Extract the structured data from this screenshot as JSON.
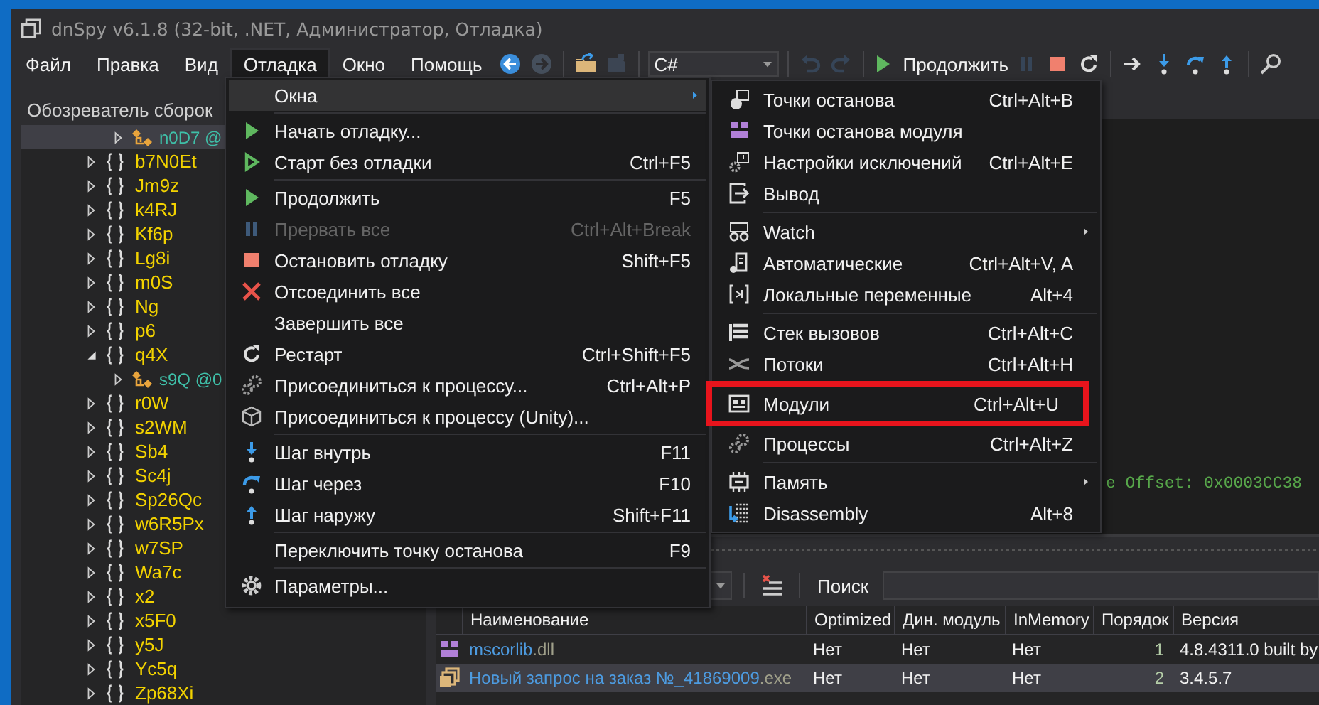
{
  "window": {
    "title": "dnSpy v6.1.8 (32-bit, .NET, Администратор, Отладка)"
  },
  "menu_bar": [
    {
      "label": "Файл",
      "selected": false
    },
    {
      "label": "Правка",
      "selected": false
    },
    {
      "label": "Вид",
      "selected": false
    },
    {
      "label": "Отладка",
      "selected": true
    },
    {
      "label": "Окно",
      "selected": false
    },
    {
      "label": "Помощь",
      "selected": false
    }
  ],
  "toolbar": [
    {
      "kind": "icon",
      "disabled": false
    },
    {
      "kind": "icon",
      "disabled": true
    },
    {
      "kind": "separator"
    },
    {
      "kind": "icon",
      "disabled": false
    },
    {
      "kind": "icon",
      "disabled": true
    },
    {
      "kind": "separator"
    },
    {
      "kind": "combo",
      "value": "C#"
    },
    {
      "kind": "separator"
    },
    {
      "kind": "icon",
      "disabled": true
    },
    {
      "kind": "icon",
      "disabled": true
    },
    {
      "kind": "separator"
    },
    {
      "kind": "labeled",
      "label": "Продолжить",
      "disabled": false
    },
    {
      "kind": "icon",
      "disabled": true
    },
    {
      "kind": "icon",
      "disabled": false
    },
    {
      "kind": "icon",
      "disabled": false
    },
    {
      "kind": "separator"
    },
    {
      "kind": "icon",
      "disabled": false
    },
    {
      "kind": "icon",
      "disabled": false
    },
    {
      "kind": "icon",
      "disabled": false
    },
    {
      "kind": "icon",
      "disabled": false
    },
    {
      "kind": "separator"
    },
    {
      "kind": "icon",
      "disabled": false
    }
  ],
  "assembly_explorer": {
    "title": "Обозреватель сборок",
    "tree": [
      {
        "kind": "type",
        "label": "n0D7 @",
        "expanded": false,
        "selected": true
      },
      {
        "kind": "namespace",
        "label": "b7N0Et",
        "expanded": false,
        "selected": false
      },
      {
        "kind": "namespace",
        "label": "Jm9z",
        "expanded": false,
        "selected": false
      },
      {
        "kind": "namespace",
        "label": "k4RJ",
        "expanded": false,
        "selected": false
      },
      {
        "kind": "namespace",
        "label": "Kf6p",
        "expanded": false,
        "selected": false
      },
      {
        "kind": "namespace",
        "label": "Lg8i",
        "expanded": false,
        "selected": false
      },
      {
        "kind": "namespace",
        "label": "m0S",
        "expanded": false,
        "selected": false
      },
      {
        "kind": "namespace",
        "label": "Ng",
        "expanded": false,
        "selected": false
      },
      {
        "kind": "namespace",
        "label": "p6",
        "expanded": false,
        "selected": false
      },
      {
        "kind": "namespace",
        "label": "q4X",
        "expanded": true,
        "selected": false,
        "children": [
          {
            "kind": "type",
            "label": "s9Q @0",
            "expanded": false,
            "selected": false
          }
        ]
      },
      {
        "kind": "namespace",
        "label": "r0W",
        "expanded": false,
        "selected": false
      },
      {
        "kind": "namespace",
        "label": "s2WM",
        "expanded": false,
        "selected": false
      },
      {
        "kind": "namespace",
        "label": "Sb4",
        "expanded": false,
        "selected": false
      },
      {
        "kind": "namespace",
        "label": "Sc4j",
        "expanded": false,
        "selected": false
      },
      {
        "kind": "namespace",
        "label": "Sp26Qc",
        "expanded": false,
        "selected": false
      },
      {
        "kind": "namespace",
        "label": "w6R5Px",
        "expanded": false,
        "selected": false
      },
      {
        "kind": "namespace",
        "label": "w7SP",
        "expanded": false,
        "selected": false
      },
      {
        "kind": "namespace",
        "label": "Wa7c",
        "expanded": false,
        "selected": false
      },
      {
        "kind": "namespace",
        "label": "x2",
        "expanded": false,
        "selected": false
      },
      {
        "kind": "namespace",
        "label": "x5F0",
        "expanded": false,
        "selected": false
      },
      {
        "kind": "namespace",
        "label": "y5J",
        "expanded": false,
        "selected": false
      },
      {
        "kind": "namespace",
        "label": "Yc5q",
        "expanded": false,
        "selected": false
      },
      {
        "kind": "namespace",
        "label": "Zp68Xi",
        "expanded": false,
        "selected": false
      }
    ]
  },
  "document": {
    "code_line": "e Offset: 0x0003CC38"
  },
  "modules_panel": {
    "search_label": "Поиск",
    "columns": [
      "Наименование",
      "Optimized",
      "Дин. модуль",
      "InMemory",
      "Порядок",
      "Версия"
    ],
    "rows": [
      {
        "kind": "dll",
        "name": "mscorlib",
        "extension": ".dll",
        "optimized": "Нет",
        "dynamic": "Нет",
        "in_memory": "Нет",
        "order": "1",
        "version": "4.8.4311.0 built by",
        "selected": false
      },
      {
        "kind": "exe",
        "name": "Новый запрос на заказ №_41869009",
        "extension": ".exe",
        "optimized": "Нет",
        "dynamic": "Нет",
        "in_memory": "Нет",
        "order": "2",
        "version": "3.4.5.7",
        "selected": true
      }
    ]
  },
  "debug_menu": {
    "items": [
      {
        "kind": "item",
        "label": "Окна",
        "submenu": true,
        "selected": true,
        "disabled": false
      },
      {
        "kind": "separator"
      },
      {
        "kind": "item",
        "label": "Начать отладку...",
        "selected": false,
        "disabled": false
      },
      {
        "kind": "item",
        "label": "Старт без отладки",
        "shortcut": "Ctrl+F5",
        "selected": false,
        "disabled": false
      },
      {
        "kind": "separator"
      },
      {
        "kind": "item",
        "label": "Продолжить",
        "shortcut": "F5",
        "selected": false,
        "disabled": false
      },
      {
        "kind": "item",
        "label": "Прервать все",
        "shortcut": "Ctrl+Alt+Break",
        "selected": false,
        "disabled": true
      },
      {
        "kind": "item",
        "label": "Остановить отладку",
        "shortcut": "Shift+F5",
        "selected": false,
        "disabled": false
      },
      {
        "kind": "item",
        "label": "Отсоединить все",
        "selected": false,
        "disabled": false
      },
      {
        "kind": "item",
        "label": "Завершить все",
        "selected": false,
        "disabled": false
      },
      {
        "kind": "item",
        "label": "Рестарт",
        "shortcut": "Ctrl+Shift+F5",
        "selected": false,
        "disabled": false
      },
      {
        "kind": "item",
        "label": "Присоединиться к процессу...",
        "shortcut": "Ctrl+Alt+P",
        "selected": false,
        "disabled": false
      },
      {
        "kind": "item",
        "label": "Присоединиться к процессу (Unity)...",
        "selected": false,
        "disabled": false
      },
      {
        "kind": "separator"
      },
      {
        "kind": "item",
        "label": "Шаг внутрь",
        "shortcut": "F11",
        "selected": false,
        "disabled": false
      },
      {
        "kind": "item",
        "label": "Шаг через",
        "shortcut": "F10",
        "selected": false,
        "disabled": false
      },
      {
        "kind": "item",
        "label": "Шаг наружу",
        "shortcut": "Shift+F11",
        "selected": false,
        "disabled": false
      },
      {
        "kind": "separator"
      },
      {
        "kind": "item",
        "label": "Переключить точку останова",
        "shortcut": "F9",
        "selected": false,
        "disabled": false
      },
      {
        "kind": "separator"
      },
      {
        "kind": "item",
        "label": "Параметры...",
        "selected": false,
        "disabled": false
      }
    ]
  },
  "windows_submenu": {
    "items": [
      {
        "kind": "item",
        "label": "Точки останова",
        "shortcut": "Ctrl+Alt+B",
        "highlighted": false
      },
      {
        "kind": "item",
        "label": "Точки останова модуля",
        "highlighted": false
      },
      {
        "kind": "item",
        "label": "Настройки исключений",
        "shortcut": "Ctrl+Alt+E",
        "highlighted": false
      },
      {
        "kind": "item",
        "label": "Вывод",
        "highlighted": false
      },
      {
        "kind": "separator"
      },
      {
        "kind": "item",
        "label": "Watch",
        "submenu": true,
        "highlighted": false
      },
      {
        "kind": "item",
        "label": "Автоматические",
        "shortcut": "Ctrl+Alt+V, A",
        "highlighted": false
      },
      {
        "kind": "item",
        "label": "Локальные переменные",
        "shortcut": "Alt+4",
        "highlighted": false
      },
      {
        "kind": "separator"
      },
      {
        "kind": "item",
        "label": "Стек вызовов",
        "shortcut": "Ctrl+Alt+C",
        "highlighted": false
      },
      {
        "kind": "item",
        "label": "Потоки",
        "shortcut": "Ctrl+Alt+H",
        "highlighted": false
      },
      {
        "kind": "item",
        "label": "Модули",
        "shortcut": "Ctrl+Alt+U",
        "highlighted": true
      },
      {
        "kind": "item",
        "label": "Процессы",
        "shortcut": "Ctrl+Alt+Z",
        "highlighted": false
      },
      {
        "kind": "separator"
      },
      {
        "kind": "item",
        "label": "Память",
        "submenu": true,
        "highlighted": false
      },
      {
        "kind": "item",
        "label": "Disassembly",
        "shortcut": "Alt+8",
        "highlighted": false
      }
    ]
  }
}
